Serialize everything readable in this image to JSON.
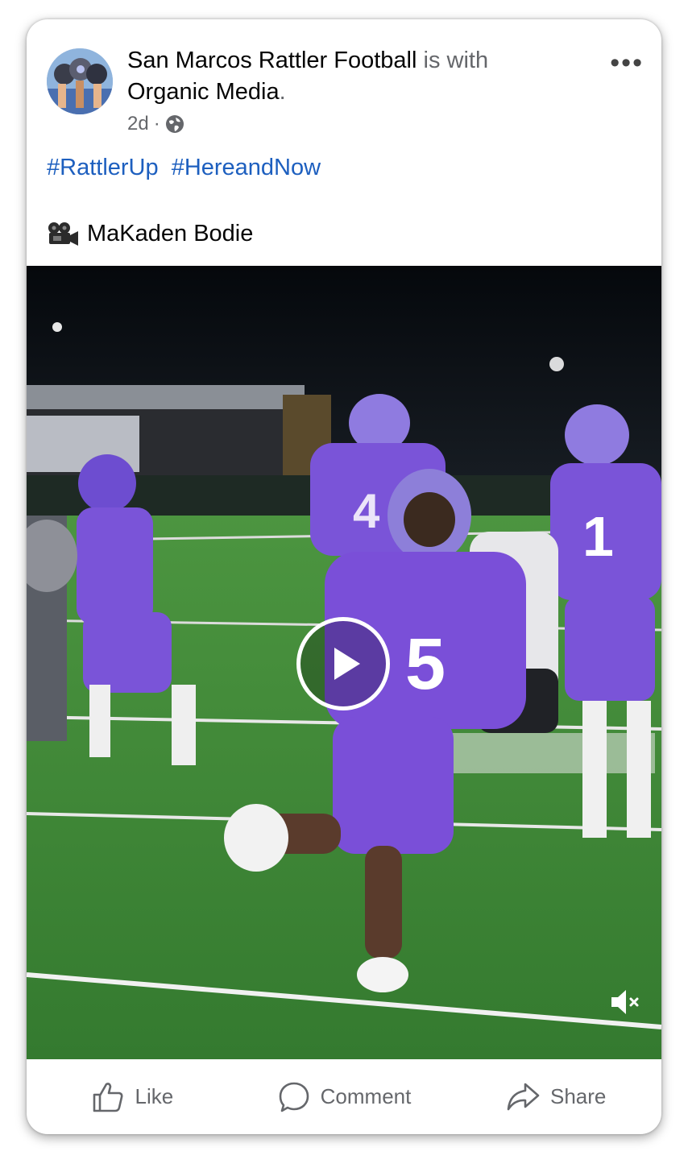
{
  "post": {
    "page_name": "San Marcos Rattler Football",
    "with_text": "is with",
    "tagged": "Organic Media",
    "period": ".",
    "time": "2d",
    "separator": "·",
    "hashtags": [
      "#RattlerUp",
      "#HereandNow"
    ],
    "credit_icon": "movie-camera-icon",
    "credit_text": "MaKaden Bodie"
  },
  "video": {
    "state": "paused",
    "muted": true
  },
  "actions": {
    "like": "Like",
    "comment": "Comment",
    "share": "Share"
  },
  "colors": {
    "link": "#1d5fbf",
    "muted_text": "#65676b",
    "jersey": "#7b4fd6",
    "field": "#3f8a38"
  }
}
